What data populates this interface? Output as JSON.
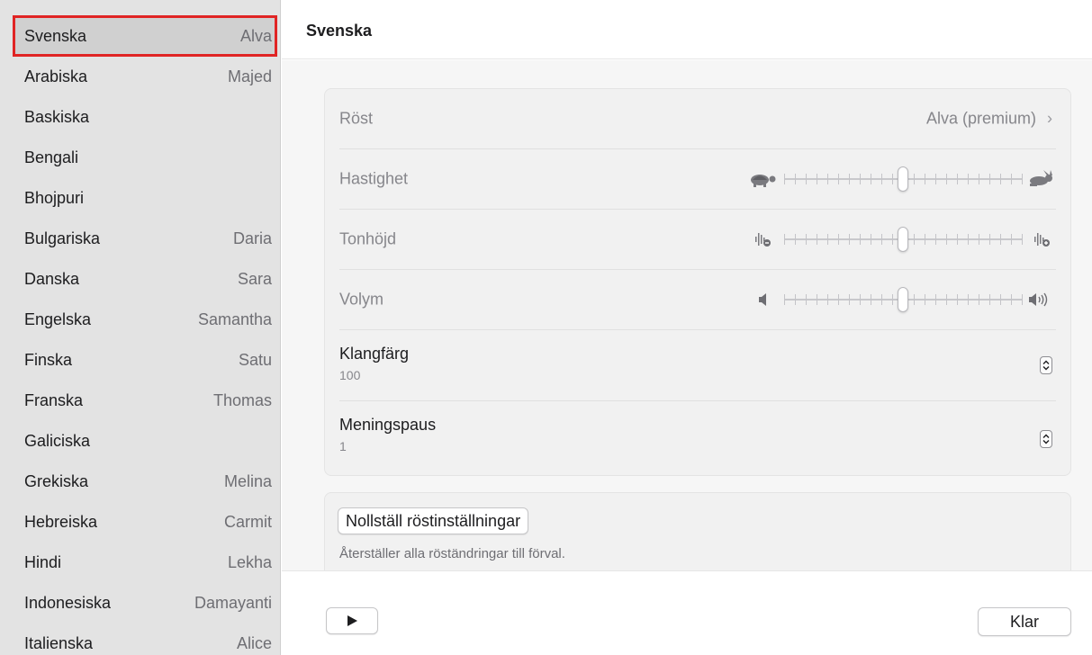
{
  "sidebar": {
    "items": [
      {
        "language": "Svenska",
        "voice": "Alva",
        "selected": true
      },
      {
        "language": "Arabiska",
        "voice": "Majed"
      },
      {
        "language": "Baskiska",
        "voice": ""
      },
      {
        "language": "Bengali",
        "voice": ""
      },
      {
        "language": "Bhojpuri",
        "voice": ""
      },
      {
        "language": "Bulgariska",
        "voice": "Daria"
      },
      {
        "language": "Danska",
        "voice": "Sara"
      },
      {
        "language": "Engelska",
        "voice": "Samantha"
      },
      {
        "language": "Finska",
        "voice": "Satu"
      },
      {
        "language": "Franska",
        "voice": "Thomas"
      },
      {
        "language": "Galiciska",
        "voice": ""
      },
      {
        "language": "Grekiska",
        "voice": "Melina"
      },
      {
        "language": "Hebreiska",
        "voice": "Carmit"
      },
      {
        "language": "Hindi",
        "voice": "Lekha"
      },
      {
        "language": "Indonesiska",
        "voice": "Damayanti"
      },
      {
        "language": "Italienska",
        "voice": "Alice"
      }
    ]
  },
  "header": {
    "title": "Svenska"
  },
  "settings": {
    "voice": {
      "label": "Röst",
      "value": "Alva (premium)"
    },
    "rate": {
      "label": "Hastighet",
      "level": 0.5,
      "left_icon": "turtle-icon",
      "right_icon": "hare-icon"
    },
    "pitch": {
      "label": "Tonhöjd",
      "level": 0.5,
      "left_icon": "pitch-down-icon",
      "right_icon": "pitch-up-icon"
    },
    "volume": {
      "label": "Volym",
      "level": 0.5,
      "left_icon": "speaker-low-icon",
      "right_icon": "speaker-high-icon"
    },
    "timbre": {
      "label": "Klangfärg",
      "value": "100"
    },
    "sentence_pause": {
      "label": "Meningspaus",
      "value": "1"
    }
  },
  "reset": {
    "button_label": "Nollställ röstinställningar",
    "description": "Återställer alla röständringar till förval."
  },
  "footer": {
    "play_icon": "play-icon",
    "done_label": "Klar"
  },
  "colors": {
    "selection_outline": "#e02424",
    "sidebar_bg": "#e3e3e3"
  }
}
